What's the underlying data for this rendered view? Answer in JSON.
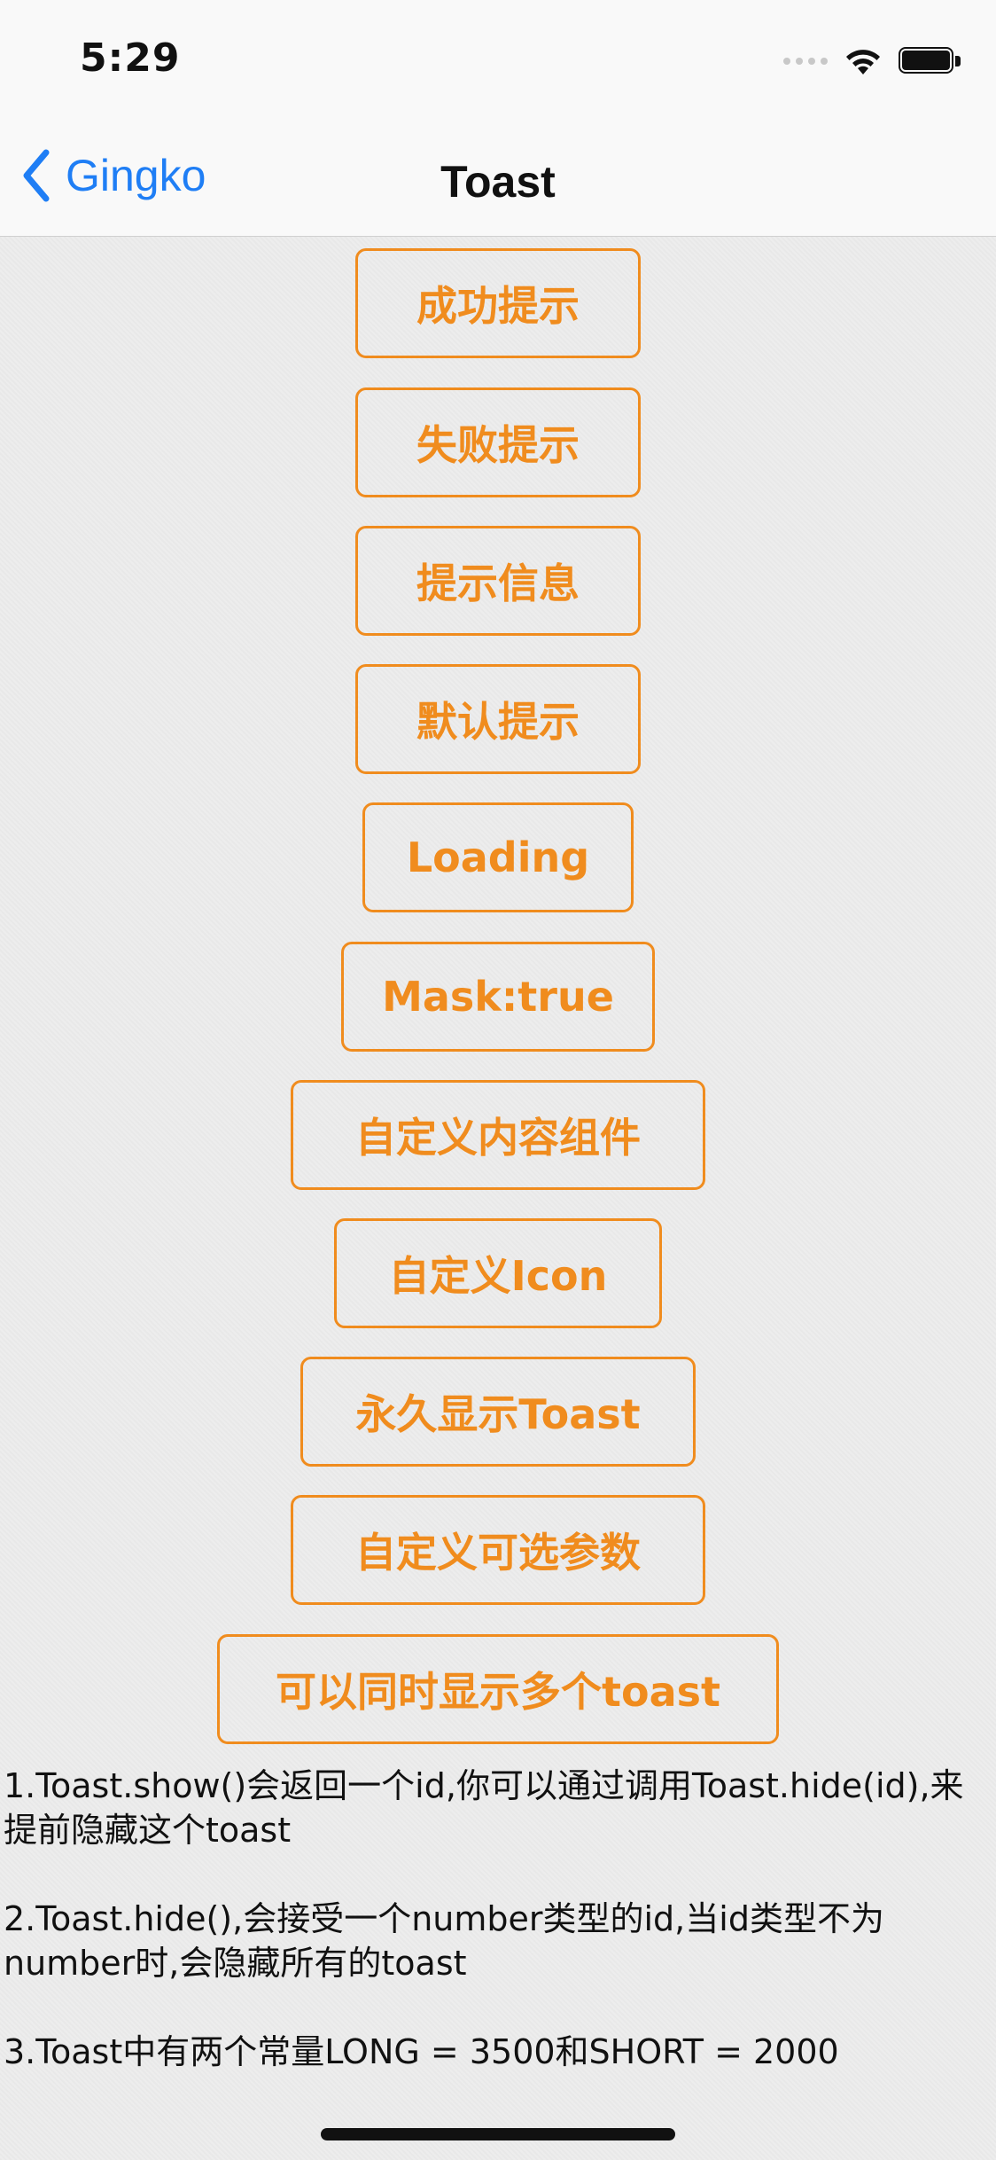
{
  "status_bar": {
    "time": "5:29",
    "icons": [
      "signal-dots-icon",
      "wifi-icon",
      "battery-icon"
    ]
  },
  "nav": {
    "back_label": "Gingko",
    "title": "Toast",
    "accent_color": "#1f7ef5"
  },
  "buttons": [
    {
      "id": "success",
      "label": "成功提示"
    },
    {
      "id": "fail",
      "label": "失败提示"
    },
    {
      "id": "info",
      "label": "提示信息"
    },
    {
      "id": "default",
      "label": "默认提示"
    },
    {
      "id": "loading",
      "label": "Loading"
    },
    {
      "id": "mask",
      "label": "Mask:true"
    },
    {
      "id": "custom-content",
      "label": "自定义内容组件"
    },
    {
      "id": "custom-icon",
      "label": "自定义Icon"
    },
    {
      "id": "permanent",
      "label": "永久显示Toast"
    },
    {
      "id": "custom-params",
      "label": "自定义可选参数"
    },
    {
      "id": "multiple",
      "label": "可以同时显示多个toast"
    }
  ],
  "button_color": "#f08c1e",
  "notes": [
    "1.Toast.show()会返回一个id,你可以通过调用Toast.hide(id),来提前隐藏这个toast",
    "2.Toast.hide(),会接受一个number类型的id,当id类型不为number时,会隐藏所有的toast",
    "3.Toast中有两个常量LONG = 3500和SHORT = 2000"
  ]
}
